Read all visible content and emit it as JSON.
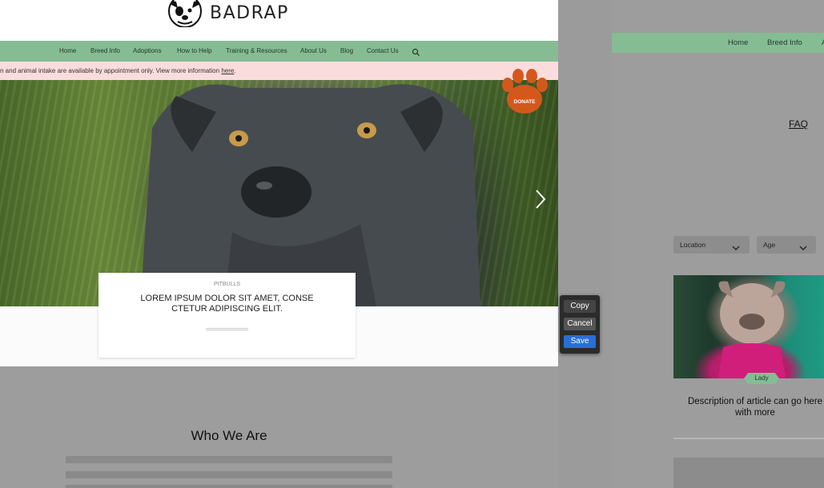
{
  "header": {
    "brand": "BADRAP"
  },
  "nav": {
    "items": [
      "Home",
      "Breed Info",
      "Adoptions",
      "How to Help",
      "Training & Resources",
      "About Us",
      "Blog",
      "Contact Us"
    ]
  },
  "alert": {
    "text": "n and animal intake are available by appointment only. View more information ",
    "link": "here",
    "suffix": "."
  },
  "donate": {
    "label": "DONATE"
  },
  "feature": {
    "category": "PITBULLS",
    "title": "LOREM IPSUM DOLOR SIT AMET, CONSE CTETUR ADIPISCING ELIT."
  },
  "about": {
    "heading": "Who We Are"
  },
  "popup": {
    "copy": "Copy",
    "cancel": "Cancel",
    "save": "Save"
  },
  "right": {
    "nav": [
      "Home",
      "Breed Info",
      "A"
    ],
    "faq": "FAQ",
    "filters": {
      "location": "Location",
      "age": "Age"
    },
    "dog": {
      "name": "Lady",
      "description": "Description of article can go here with more"
    }
  },
  "colors": {
    "nav_green": "#86bc94",
    "alert_pink": "#fbdcdd",
    "donate_orange": "#d4581c",
    "save_blue": "#2a6fd6"
  }
}
